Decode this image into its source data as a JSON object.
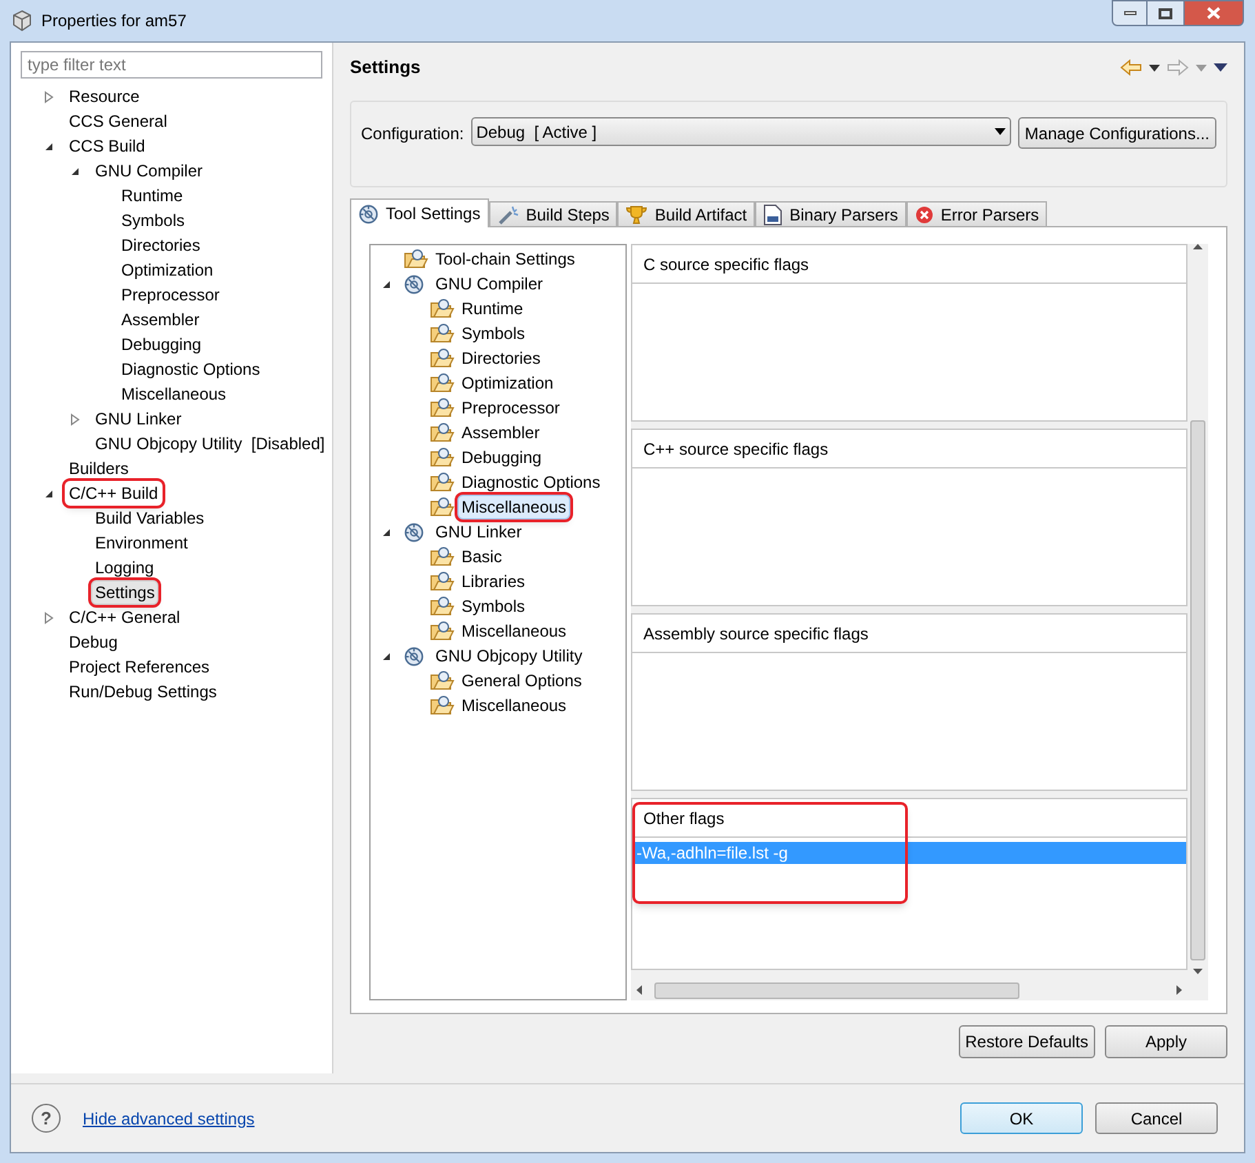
{
  "window": {
    "title": "Properties for am57"
  },
  "filter": {
    "placeholder": "type filter text"
  },
  "nav_tree": [
    {
      "label": "Resource",
      "expanded": false,
      "selected": false
    },
    {
      "label": "CCS General",
      "selected": false
    },
    {
      "label": "CCS Build",
      "expanded": true,
      "selected": false,
      "children": [
        {
          "label": "GNU Compiler",
          "expanded": true,
          "selected": false,
          "children": [
            {
              "label": "Runtime",
              "selected": false
            },
            {
              "label": "Symbols",
              "selected": false
            },
            {
              "label": "Directories",
              "selected": false
            },
            {
              "label": "Optimization",
              "selected": false
            },
            {
              "label": "Preprocessor",
              "selected": false
            },
            {
              "label": "Assembler",
              "selected": false
            },
            {
              "label": "Debugging",
              "selected": false
            },
            {
              "label": "Diagnostic Options",
              "selected": false
            },
            {
              "label": "Miscellaneous",
              "selected": false
            }
          ]
        },
        {
          "label": "GNU Linker",
          "expanded": false,
          "selected": false
        },
        {
          "label": "GNU Objcopy Utility  [Disabled]",
          "selected": false
        }
      ]
    },
    {
      "label": "Builders",
      "selected": false
    },
    {
      "label": "C/C++ Build",
      "expanded": true,
      "selected": false,
      "annotated": true,
      "children": [
        {
          "label": "Build Variables",
          "selected": false
        },
        {
          "label": "Environment",
          "selected": false
        },
        {
          "label": "Logging",
          "selected": false
        },
        {
          "label": "Settings",
          "selected": true,
          "annotated": true
        }
      ]
    },
    {
      "label": "C/C++ General",
      "expanded": false,
      "selected": false
    },
    {
      "label": "Debug",
      "selected": false
    },
    {
      "label": "Project References",
      "selected": false
    },
    {
      "label": "Run/Debug Settings",
      "selected": false
    }
  ],
  "page": {
    "title": "Settings"
  },
  "configuration": {
    "label": "Configuration:",
    "value": "Debug  [ Active ]",
    "button": "Manage Configurations..."
  },
  "tabs": [
    {
      "label": "Tool Settings",
      "kind": "tool",
      "selected": true
    },
    {
      "label": "Build Steps",
      "kind": "steps",
      "selected": false
    },
    {
      "label": "Build Artifact",
      "kind": "artifact",
      "selected": false
    },
    {
      "label": "Binary Parsers",
      "kind": "binary",
      "selected": false
    },
    {
      "label": "Error Parsers",
      "kind": "error",
      "selected": false
    }
  ],
  "tool_tree": [
    {
      "label": "Tool-chain Settings",
      "kind": "category",
      "selected": false
    },
    {
      "label": "GNU Compiler",
      "kind": "tool",
      "expanded": true,
      "selected": false,
      "children": [
        {
          "label": "Runtime",
          "kind": "category",
          "selected": false
        },
        {
          "label": "Symbols",
          "kind": "category",
          "selected": false
        },
        {
          "label": "Directories",
          "kind": "category",
          "selected": false
        },
        {
          "label": "Optimization",
          "kind": "category",
          "selected": false
        },
        {
          "label": "Preprocessor",
          "kind": "category",
          "selected": false
        },
        {
          "label": "Assembler",
          "kind": "category",
          "selected": false
        },
        {
          "label": "Debugging",
          "kind": "category",
          "selected": false
        },
        {
          "label": "Diagnostic Options",
          "kind": "category",
          "selected": false
        },
        {
          "label": "Miscellaneous",
          "kind": "category",
          "selected": true,
          "annotated": true
        }
      ]
    },
    {
      "label": "GNU Linker",
      "kind": "tool",
      "expanded": true,
      "selected": false,
      "children": [
        {
          "label": "Basic",
          "kind": "category",
          "selected": false
        },
        {
          "label": "Libraries",
          "kind": "category",
          "selected": false
        },
        {
          "label": "Symbols",
          "kind": "category",
          "selected": false
        },
        {
          "label": "Miscellaneous",
          "kind": "category",
          "selected": false
        }
      ]
    },
    {
      "label": "GNU Objcopy Utility",
      "kind": "tool",
      "expanded": true,
      "selected": false,
      "children": [
        {
          "label": "General Options",
          "kind": "category",
          "selected": false
        },
        {
          "label": "Miscellaneous",
          "kind": "category",
          "selected": false
        }
      ]
    }
  ],
  "flag_sections": [
    {
      "title": "C source specific flags"
    },
    {
      "title": "C++ source specific flags"
    },
    {
      "title": "Assembly source specific flags"
    },
    {
      "title": "Other flags",
      "annotated": true,
      "lines": [
        {
          "text": "-Wa,-adhln=file.lst -g",
          "selected": true
        }
      ]
    }
  ],
  "page_buttons": [
    "Restore Defaults",
    "Apply"
  ],
  "footer": {
    "help": "?",
    "link": "Hide advanced settings",
    "buttons": [
      {
        "label": "OK",
        "kind": "default"
      },
      {
        "label": "Cancel",
        "kind": "normal"
      }
    ]
  }
}
